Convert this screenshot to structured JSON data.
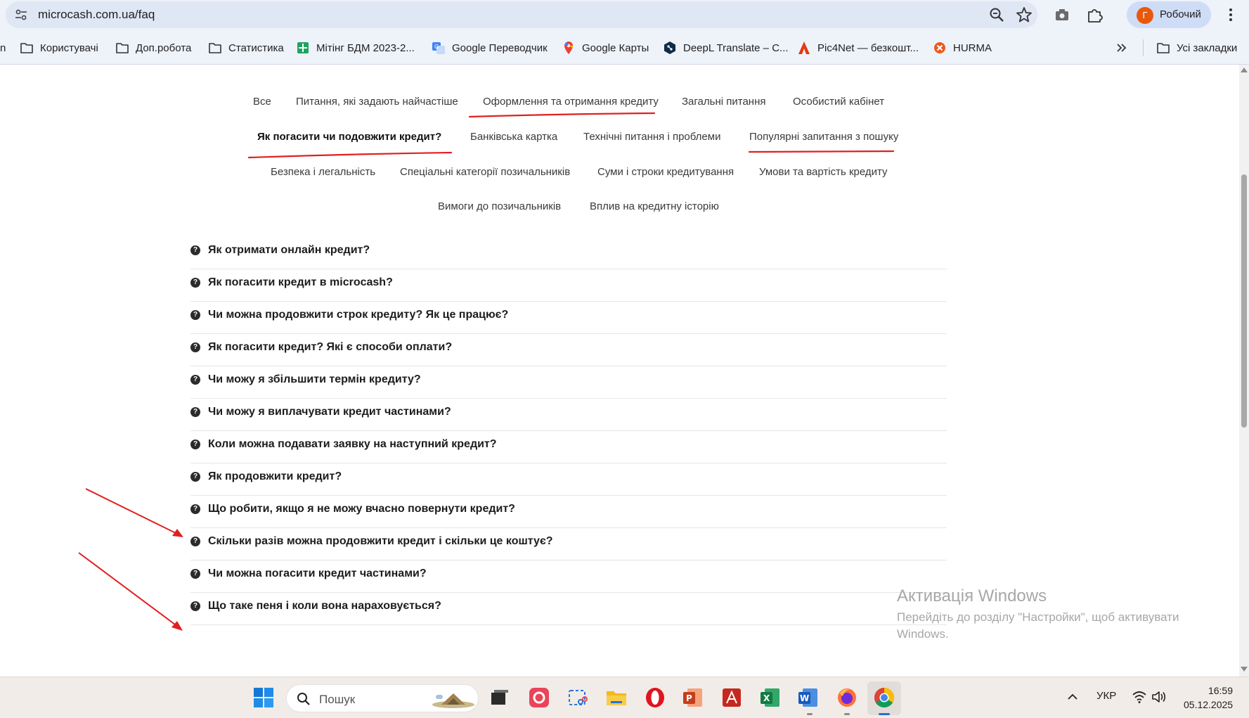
{
  "browser": {
    "url": "microcash.com.ua/faq",
    "profile": {
      "initial": "Г",
      "name": "Робочий",
      "color": "#e8580c"
    },
    "bookmarks": [
      {
        "label": "Користувачі",
        "icon": "folder-icon"
      },
      {
        "label": "Доп.робота",
        "icon": "folder-icon"
      },
      {
        "label": "Статистика",
        "icon": "folder-icon"
      },
      {
        "label": "Мітінг БДМ 2023-2...",
        "icon": "sheets-icon"
      },
      {
        "label": "Google Переводчик",
        "icon": "google-translate-icon"
      },
      {
        "label": "Google Карты",
        "icon": "google-maps-icon"
      },
      {
        "label": "DeepL Translate – С...",
        "icon": "deepl-icon"
      },
      {
        "label": "Pic4Net — безкошт...",
        "icon": "pic4net-icon"
      },
      {
        "label": "HURMA",
        "icon": "hurma-icon"
      }
    ],
    "all_bookmarks": "Усі закладки"
  },
  "faq": {
    "tabs": [
      {
        "label": "Все",
        "active": false
      },
      {
        "label": "Питання, які задають найчастіше",
        "active": false
      },
      {
        "label": "Оформлення та отримання кредиту",
        "active": false,
        "underlined": true
      },
      {
        "label": "Загальні питання",
        "active": false
      },
      {
        "label": "Особистий кабінет",
        "active": false
      },
      {
        "label": "Як погасити чи подовжити кредит?",
        "active": true,
        "underlined": true
      },
      {
        "label": "Банківська картка",
        "active": false
      },
      {
        "label": "Технічні питання і проблеми",
        "active": false
      },
      {
        "label": "Популярні запитання з пошуку",
        "active": false,
        "underlined": true
      },
      {
        "label": "Безпека і легальність",
        "active": false
      },
      {
        "label": "Спеціальні категорії позичальників",
        "active": false
      },
      {
        "label": "Суми і строки кредитування",
        "active": false
      },
      {
        "label": "Умови та вартість кредиту",
        "active": false
      },
      {
        "label": "Вимоги до позичальників",
        "active": false
      },
      {
        "label": "Вплив на кредитну історію",
        "active": false
      }
    ],
    "questions": [
      {
        "text": "Як отримати онлайн кредит?",
        "arrow": false
      },
      {
        "text": "Як погасити кредит в microcash?",
        "arrow": false
      },
      {
        "text": "Чи можна продовжити строк кредиту? Як це працює?",
        "arrow": false
      },
      {
        "text": "Як погасити кредит? Які є способи оплати?",
        "arrow": false
      },
      {
        "text": "Чи можу я збільшити термін кредиту?",
        "arrow": false
      },
      {
        "text": "Чи можу я виплачувати кредит частинами?",
        "arrow": false
      },
      {
        "text": "Коли можна подавати заявку на наступний кредит?",
        "arrow": false
      },
      {
        "text": "Як продовжити кредит?",
        "arrow": false
      },
      {
        "text": "Що робити, якщо я не можу вчасно повернути кредит?",
        "arrow": true
      },
      {
        "text": "Скільки разів можна продовжити кредит і скільки це коштує?",
        "arrow": false
      },
      {
        "text": "Чи можна погасити кредит частинами?",
        "arrow": false
      },
      {
        "text": "Що таке пеня і коли вона нараховується?",
        "arrow": true
      }
    ],
    "annotation_color": "#e02020"
  },
  "watermark": {
    "title": "Активація Windows",
    "subtitle": "Перейдіть до розділу \"Настройки\", щоб активувати Windows."
  },
  "taskbar": {
    "search_placeholder": "Пошук",
    "language": "УКР",
    "time": "16:59",
    "date": "05.12.2025"
  }
}
